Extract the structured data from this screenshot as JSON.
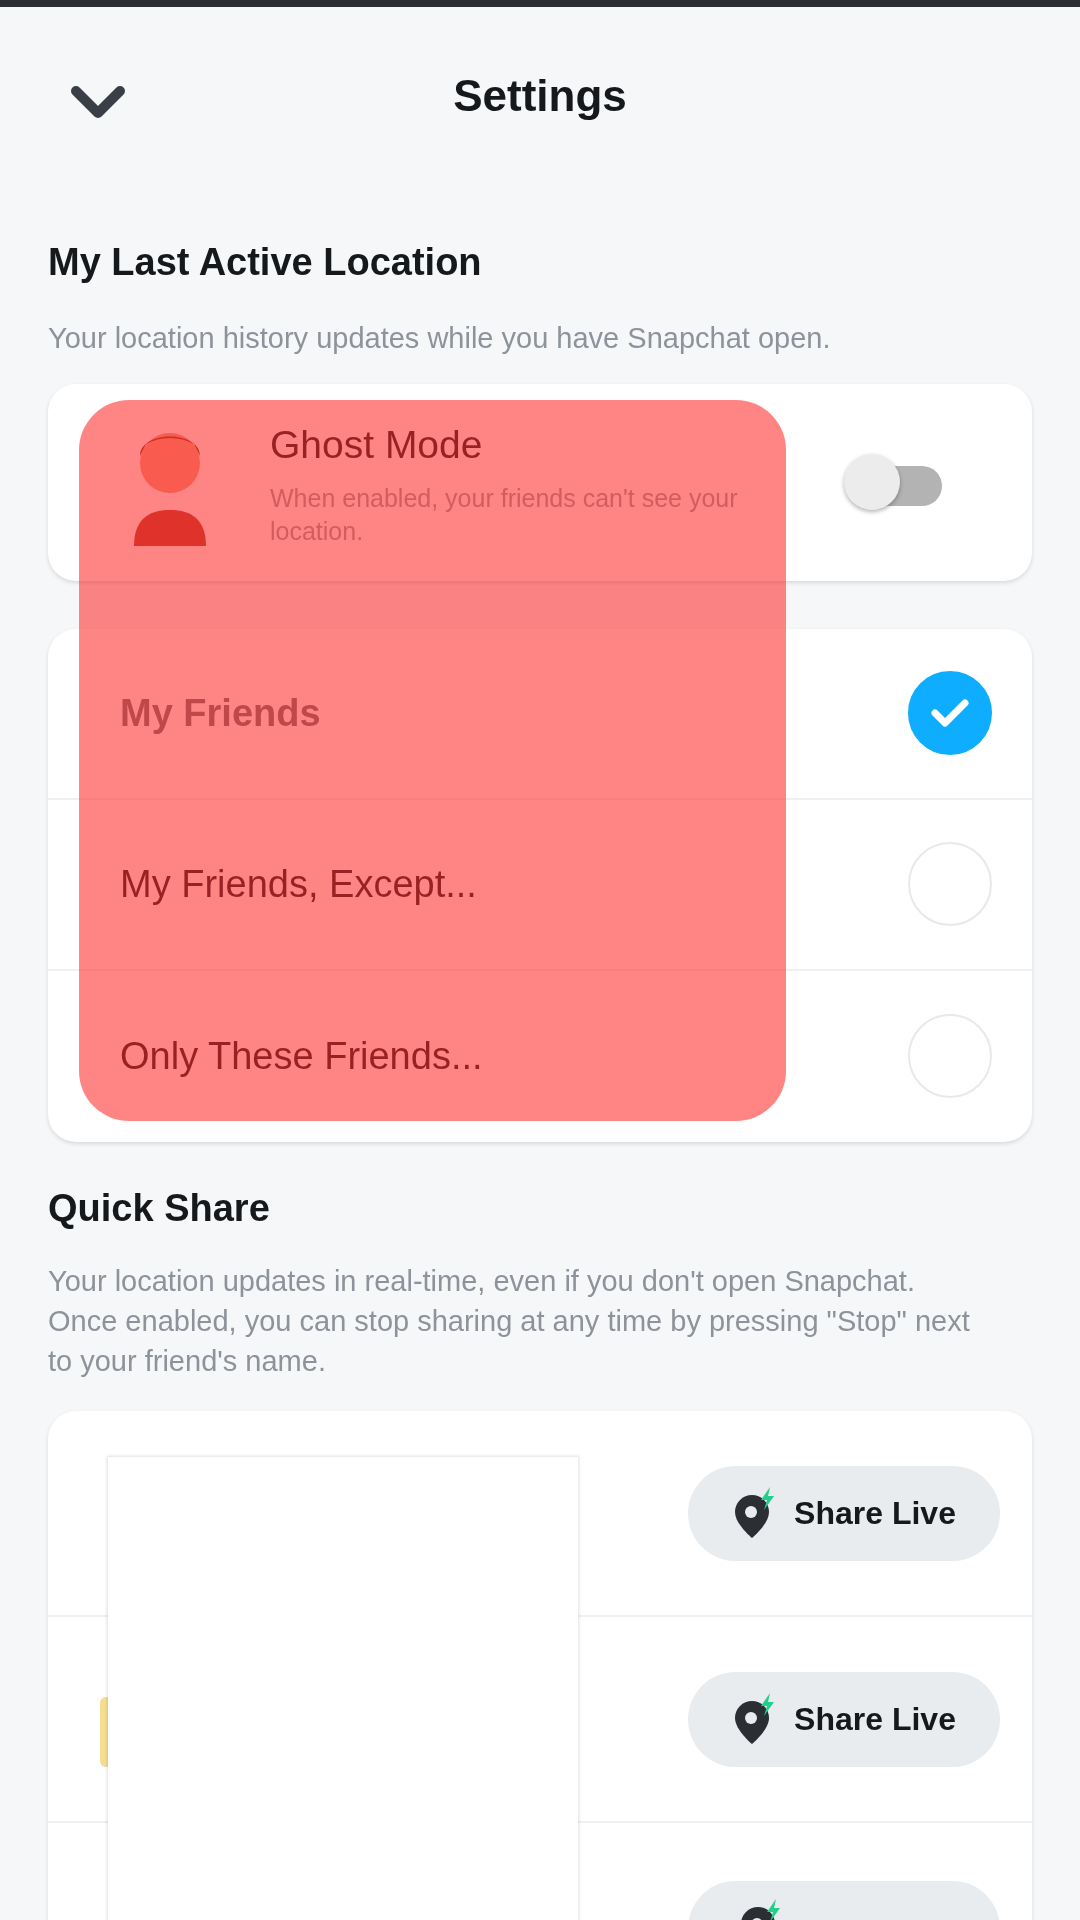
{
  "header": {
    "title": "Settings"
  },
  "last_active": {
    "heading": "My Last Active Location",
    "description": "Your location history updates while you have Snapchat open.",
    "ghost_mode": {
      "title": "Ghost Mode",
      "description": "When enabled, your friends can't see your location.",
      "on": false
    },
    "options": [
      {
        "label": "My Friends",
        "selected": true
      },
      {
        "label": "My Friends, Except...",
        "selected": false
      },
      {
        "label": "Only These Friends...",
        "selected": false
      }
    ]
  },
  "quick_share": {
    "heading": "Quick Share",
    "description": "Your location updates in real-time, even if you don't open Snapchat. Once enabled, you can stop sharing at any time by pressing \"Stop\" next to your friend's name.",
    "rows": [
      {
        "kind": "full",
        "button": "Share Live"
      },
      {
        "kind": "full",
        "button": "Share Live"
      },
      {
        "kind": "cut"
      }
    ]
  }
}
